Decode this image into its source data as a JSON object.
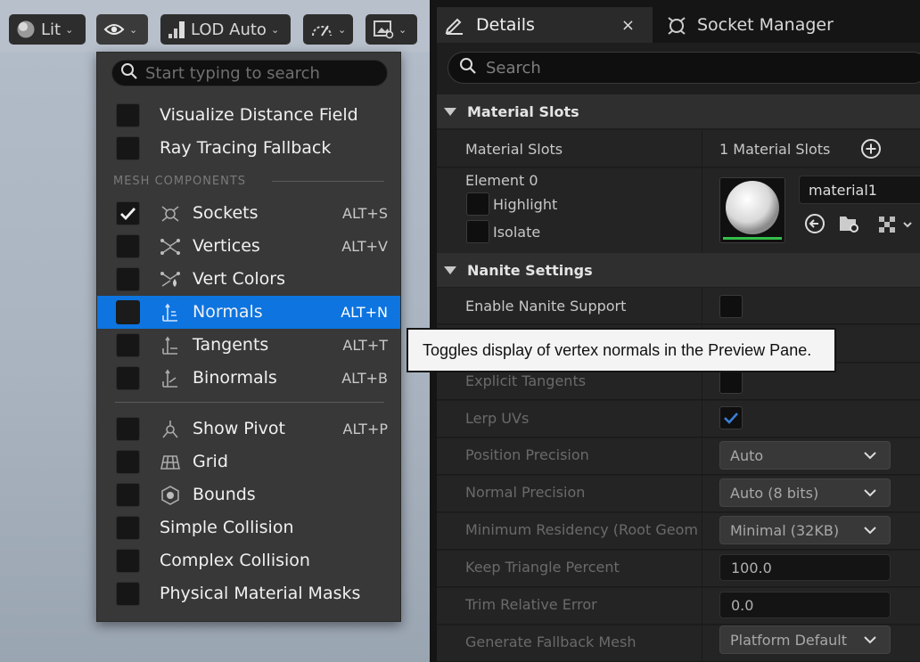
{
  "viewport_toolbar": {
    "lit_label": "Lit",
    "lod_label": "LOD Auto"
  },
  "details": {
    "tab_details": "Details",
    "tab_socket_manager": "Socket Manager",
    "close_glyph": "×",
    "search_placeholder": "Search",
    "material_slots_section": "Material Slots",
    "material_slots_label": "Material Slots",
    "material_slots_value": "1 Material Slots",
    "element_label": "Element 0",
    "highlight_label": "Highlight",
    "isolate_label": "Isolate",
    "material_name": "material1",
    "nanite_section": "Nanite Settings",
    "rows": [
      {
        "name": "Enable Nanite Support"
      },
      {
        "name": "Explicit Tangents"
      },
      {
        "name": "Lerp UVs"
      },
      {
        "name": "Position Precision",
        "value": "Auto"
      },
      {
        "name": "Normal Precision",
        "value": "Auto (8 bits)"
      },
      {
        "name": "Minimum Residency (Root Geome",
        "value": "Minimal (32KB)"
      },
      {
        "name": "Keep Triangle Percent",
        "value": "100.0"
      },
      {
        "name": "Trim Relative Error",
        "value": "0.0"
      },
      {
        "name": "Generate Fallback Mesh",
        "value": "Platform Default"
      }
    ],
    "lerp_uvs_checked": true
  },
  "menu": {
    "search_placeholder": "Start typing to search",
    "section_header": "MESH COMPONENTS",
    "items_top": [
      {
        "label": "Visualize Distance Field",
        "checked": false
      },
      {
        "label": "Ray Tracing Fallback",
        "checked": false
      }
    ],
    "items_mesh": [
      {
        "label": "Sockets",
        "shortcut": "ALT+S",
        "checked": true,
        "icon": "socket-icon"
      },
      {
        "label": "Vertices",
        "shortcut": "ALT+V",
        "checked": false,
        "icon": "vertices-icon"
      },
      {
        "label": "Vert Colors",
        "shortcut": "",
        "checked": false,
        "icon": "vert-colors-icon"
      },
      {
        "label": "Normals",
        "shortcut": "ALT+N",
        "checked": false,
        "icon": "normals-icon",
        "highlighted": true
      },
      {
        "label": "Tangents",
        "shortcut": "ALT+T",
        "checked": false,
        "icon": "tangents-icon"
      },
      {
        "label": "Binormals",
        "shortcut": "ALT+B",
        "checked": false,
        "icon": "binormals-icon"
      }
    ],
    "items_bottom": [
      {
        "label": "Show Pivot",
        "shortcut": "ALT+P",
        "checked": false,
        "icon": "pivot-icon"
      },
      {
        "label": "Grid",
        "shortcut": "",
        "checked": false,
        "icon": "grid-icon"
      },
      {
        "label": "Bounds",
        "shortcut": "",
        "checked": false,
        "icon": "bounds-icon"
      },
      {
        "label": "Simple Collision",
        "checked": false
      },
      {
        "label": "Complex Collision",
        "checked": false
      },
      {
        "label": "Physical Material Masks",
        "checked": false
      }
    ]
  },
  "tooltip": "Toggles display of vertex normals in the Preview Pane.",
  "colors": {
    "accent": "#0d74e0",
    "panel": "#242424",
    "menu": "#383838",
    "viewport": "#aab4c0"
  }
}
